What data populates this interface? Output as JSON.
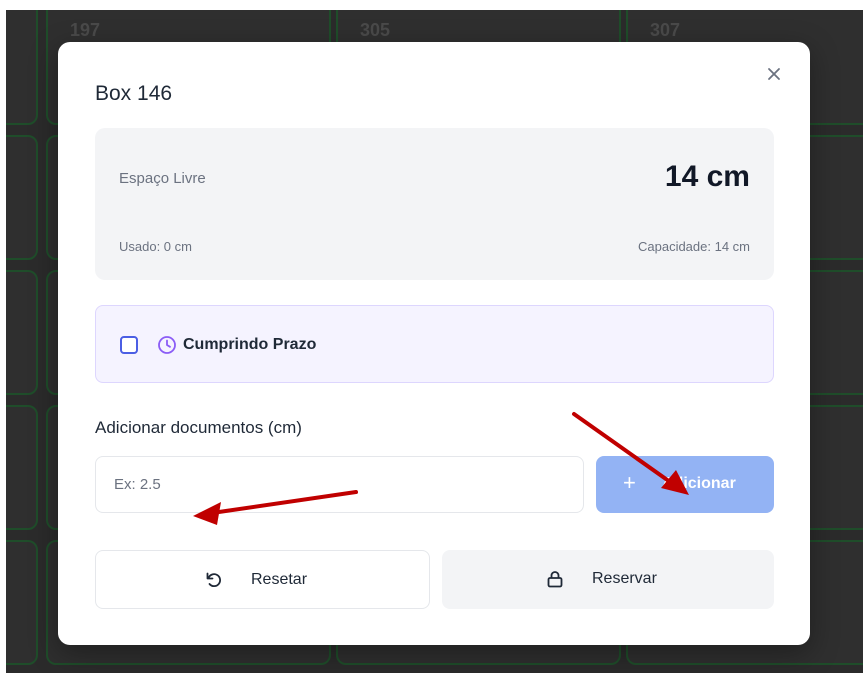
{
  "background": {
    "cell_labels": [
      "197",
      "305",
      "307"
    ]
  },
  "modal": {
    "title": "Box 146",
    "close_icon": "close-icon",
    "stats": {
      "free_label": "Espaço Livre",
      "free_value": "14 cm",
      "used_label": "Usado: 0 cm",
      "capacity_label": "Capacidade: 14 cm"
    },
    "deadline": {
      "checked": false,
      "icon": "clock-icon",
      "label": "Cumprindo Prazo",
      "accent_color": "#8b5cf6"
    },
    "add_documents": {
      "label": "Adicionar documentos (cm)",
      "input_value": "",
      "input_placeholder": "Ex: 2.5",
      "button_icon": "plus-icon",
      "button_label": "Adicionar",
      "button_color": "#93b3f4"
    },
    "actions": {
      "reset_icon": "rotate-ccw-icon",
      "reset_label": "Resetar",
      "reserve_icon": "lock-icon",
      "reserve_label": "Reservar"
    }
  },
  "annotations": {
    "arrow_color": "#c00000"
  }
}
